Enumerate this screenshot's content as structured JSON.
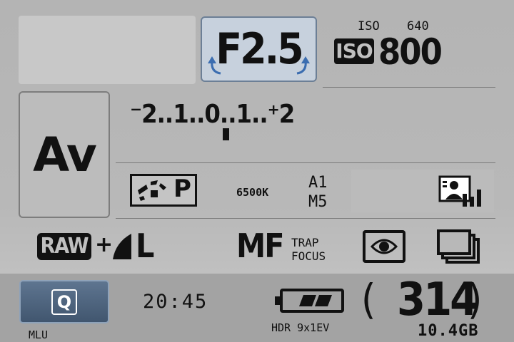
{
  "shooting": {
    "aperture": "F2.5",
    "iso_top_left": "ISO",
    "iso_top_right": "640",
    "iso_badge": "ISO",
    "iso_value": "800",
    "mode": "Av"
  },
  "exposure_comp": {
    "scale": "⁻2..1..0..1..⁺2",
    "value": 0
  },
  "white_balance": {
    "mode_letter": "P",
    "kelvin": "6500K",
    "shift_line1": "A1",
    "shift_line2": "M5"
  },
  "quality": {
    "raw_label": "RAW",
    "plus": "+",
    "size": "L"
  },
  "focus": {
    "mode": "MF",
    "trap_line1": "TRAP",
    "trap_line2": "FOCUS"
  },
  "bottom_bar": {
    "quick_label": "Q",
    "time": "20:45",
    "mlu": "MLU",
    "hdr": "HDR 9x1EV",
    "open_paren": "(",
    "shots_remaining": "314",
    "close_paren": ")",
    "card_space": "10.4GB",
    "battery_level": 0.67
  },
  "icons": [
    "white-balance-custom-icon",
    "picture-style-icon",
    "metering-evaluative-icon",
    "drive-continuous-icon",
    "battery-icon",
    "aperture-dial-arrows-icon"
  ],
  "colors": {
    "panel_bg": "#b8b8b8",
    "bottom_bar_bg": "#a3a3a3",
    "aperture_highlight": "#c7d1dd",
    "aperture_border": "#6c7f96",
    "quick_button": "#4d637d",
    "text": "#111111"
  }
}
